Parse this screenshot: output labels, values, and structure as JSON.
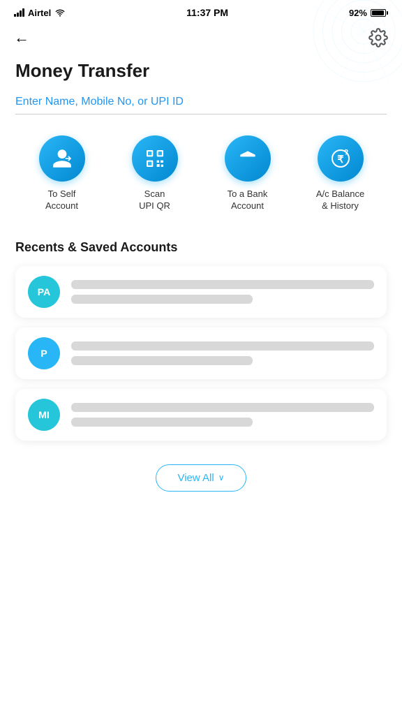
{
  "status_bar": {
    "carrier": "Airtel",
    "wifi": "wifi",
    "time": "11:37 PM",
    "battery_icon": "battery",
    "battery_percent": "92%"
  },
  "nav": {
    "back_label": "←",
    "settings_label": "⚙"
  },
  "page": {
    "title": "Money Transfer"
  },
  "search": {
    "placeholder": "Enter Name, Mobile No, or UPI ID"
  },
  "quick_actions": [
    {
      "id": "self-account",
      "label": "To Self\nAccount",
      "line1": "To Self",
      "line2": "Account"
    },
    {
      "id": "scan-upi",
      "label": "Scan\nUPI QR",
      "line1": "Scan",
      "line2": "UPI QR"
    },
    {
      "id": "bank-account",
      "label": "To a Bank\nAccount",
      "line1": "To a Bank",
      "line2": "Account"
    },
    {
      "id": "ac-balance",
      "label": "A/c Balance\n& History",
      "line1": "A/c Balance",
      "line2": "& History"
    }
  ],
  "recents": {
    "title": "Recents & Saved Accounts",
    "items": [
      {
        "initials": "PA",
        "avatar_class": "avatar-teal"
      },
      {
        "initials": "P",
        "avatar_class": "avatar-blue"
      },
      {
        "initials": "MI",
        "avatar_class": "avatar-teal2"
      }
    ]
  },
  "view_all": {
    "label": "View All",
    "chevron": "∨"
  }
}
